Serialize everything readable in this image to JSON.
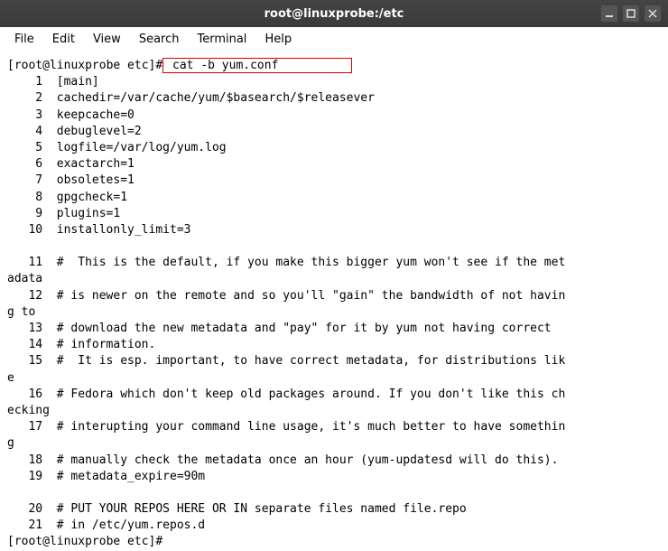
{
  "titlebar": {
    "title": "root@linuxprobe:/etc"
  },
  "menubar": [
    "File",
    "Edit",
    "View",
    "Search",
    "Terminal",
    "Help"
  ],
  "prompt": {
    "prefix": "[root@linuxprobe etc]#",
    "command": " cat -b yum.conf          "
  },
  "lines": [
    {
      "n": 1,
      "t": "[main]"
    },
    {
      "n": 2,
      "t": "cachedir=/var/cache/yum/$basearch/$releasever"
    },
    {
      "n": 3,
      "t": "keepcache=0"
    },
    {
      "n": 4,
      "t": "debuglevel=2"
    },
    {
      "n": 5,
      "t": "logfile=/var/log/yum.log"
    },
    {
      "n": 6,
      "t": "exactarch=1"
    },
    {
      "n": 7,
      "t": "obsoletes=1"
    },
    {
      "n": 8,
      "t": "gpgcheck=1"
    },
    {
      "n": 9,
      "t": "plugins=1"
    },
    {
      "n": 10,
      "t": "installonly_limit=3"
    },
    {
      "blank": true
    },
    {
      "n": 11,
      "t": "#  This is the default, if you make this bigger yum won't see if the met",
      "wrap": "adata"
    },
    {
      "n": 12,
      "t": "# is newer on the remote and so you'll \"gain\" the bandwidth of not havin",
      "wrap": "g to"
    },
    {
      "n": 13,
      "t": "# download the new metadata and \"pay\" for it by yum not having correct"
    },
    {
      "n": 14,
      "t": "# information."
    },
    {
      "n": 15,
      "t": "#  It is esp. important, to have correct metadata, for distributions lik",
      "wrap": "e"
    },
    {
      "n": 16,
      "t": "# Fedora which don't keep old packages around. If you don't like this ch",
      "wrap": "ecking"
    },
    {
      "n": 17,
      "t": "# interupting your command line usage, it's much better to have somethin",
      "wrap": "g"
    },
    {
      "n": 18,
      "t": "# manually check the metadata once an hour (yum-updatesd will do this)."
    },
    {
      "n": 19,
      "t": "# metadata_expire=90m"
    },
    {
      "blank": true
    },
    {
      "n": 20,
      "t": "# PUT YOUR REPOS HERE OR IN separate files named file.repo"
    },
    {
      "n": 21,
      "t": "# in /etc/yum.repos.d"
    }
  ],
  "prompt2": "[root@linuxprobe etc]#"
}
